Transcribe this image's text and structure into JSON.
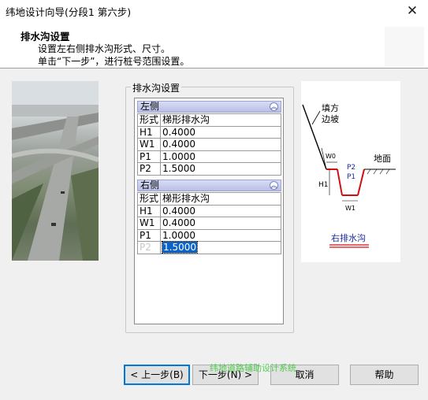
{
  "window": {
    "title": "纬地设计向导(分段1 第六步)",
    "close_glyph": "✕"
  },
  "header": {
    "title": "排水沟设置",
    "line1": "设置左右侧排水沟形式、尺寸。",
    "line2": "单击“下一步”，进行桩号范围设置。"
  },
  "groupbox": {
    "label": "排水沟设置"
  },
  "left_section": {
    "title": "左侧",
    "collapse_glyph": "︽",
    "rows": [
      {
        "key": "形式",
        "value": "梯形排水沟"
      },
      {
        "key": "H1",
        "value": "0.4000"
      },
      {
        "key": "W1",
        "value": "0.4000"
      },
      {
        "key": "P1",
        "value": "1.0000"
      },
      {
        "key": "P2",
        "value": "1.5000"
      }
    ]
  },
  "right_section": {
    "title": "右侧",
    "collapse_glyph": "︽",
    "rows": [
      {
        "key": "形式",
        "value": "梯形排水沟"
      },
      {
        "key": "H1",
        "value": "0.4000"
      },
      {
        "key": "W1",
        "value": "0.4000"
      },
      {
        "key": "P1",
        "value": "1.0000"
      }
    ],
    "editing_row": {
      "key": "P2",
      "value": "1.5000"
    }
  },
  "diagram": {
    "fill_label_1": "填方",
    "fill_label_2": "边坡",
    "ground_label": "地面",
    "w0": "W0",
    "p2": "P2",
    "p1": "P1",
    "h1": "H1",
    "w1": "W1",
    "caption": "右排水沟"
  },
  "buttons": {
    "back": "< 上一步(B)",
    "next": "下一步(N) >",
    "cancel": "取消",
    "help": "帮助"
  },
  "watermark": "纬地道路辅助设计系统"
}
